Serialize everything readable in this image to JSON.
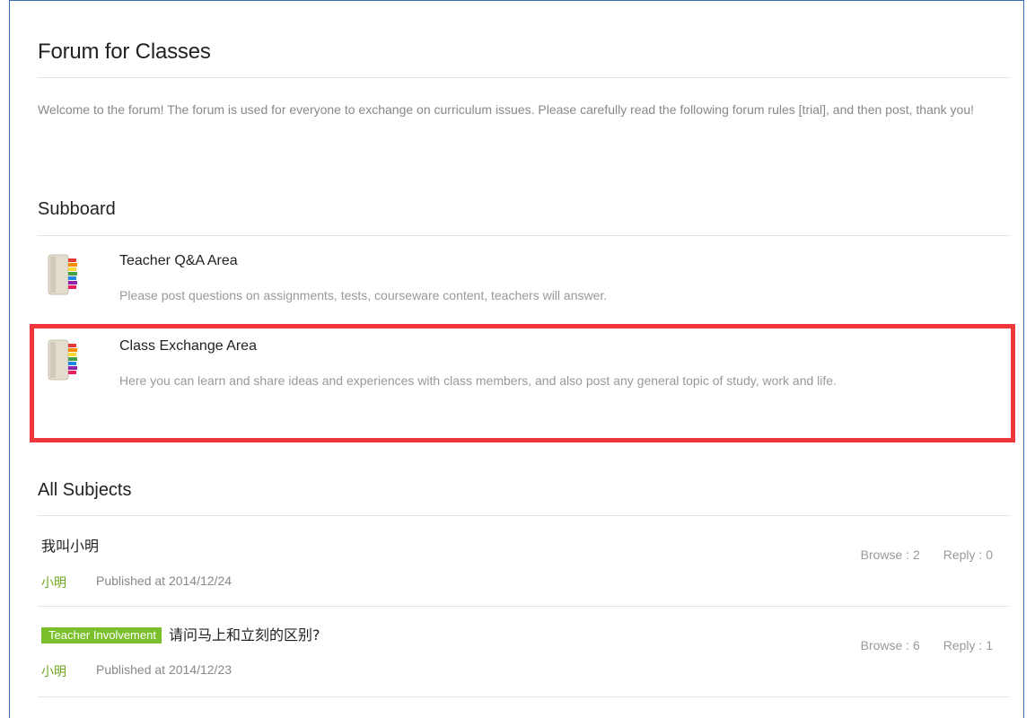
{
  "forum": {
    "title": "Forum for Classes",
    "intro": "Welcome to the forum! The forum is used for everyone to exchange on curriculum issues. Please carefully read the following forum rules [trial], and then post, thank you!"
  },
  "subboard": {
    "heading": "Subboard",
    "boards": [
      {
        "icon": "book-stack-icon",
        "name": "Teacher Q&A Area",
        "description": "Please post questions on assignments, tests, courseware content, teachers will answer."
      },
      {
        "icon": "book-stack-icon",
        "name": "Class Exchange Area",
        "description": "Here you can learn and share ideas and experiences with class members, and also post any general topic of study, work and life."
      }
    ]
  },
  "subjects": {
    "heading": "All Subjects",
    "items": [
      {
        "tag": "",
        "title": "我叫小明",
        "author": "小明",
        "published": "Published at 2014/12/24",
        "browse": "Browse : 2",
        "reply": "Reply : 0"
      },
      {
        "tag": "Teacher Involvement",
        "title": "请问马上和立刻的区别?",
        "author": "小明",
        "published": "Published at 2014/12/23",
        "browse": "Browse : 6",
        "reply": "Reply : 1"
      }
    ]
  },
  "colors": {
    "highlight_border": "#f0383a",
    "tag_background": "#7cbf2c",
    "author_text": "#6aa51b",
    "frame_border": "#3a6fb5"
  }
}
